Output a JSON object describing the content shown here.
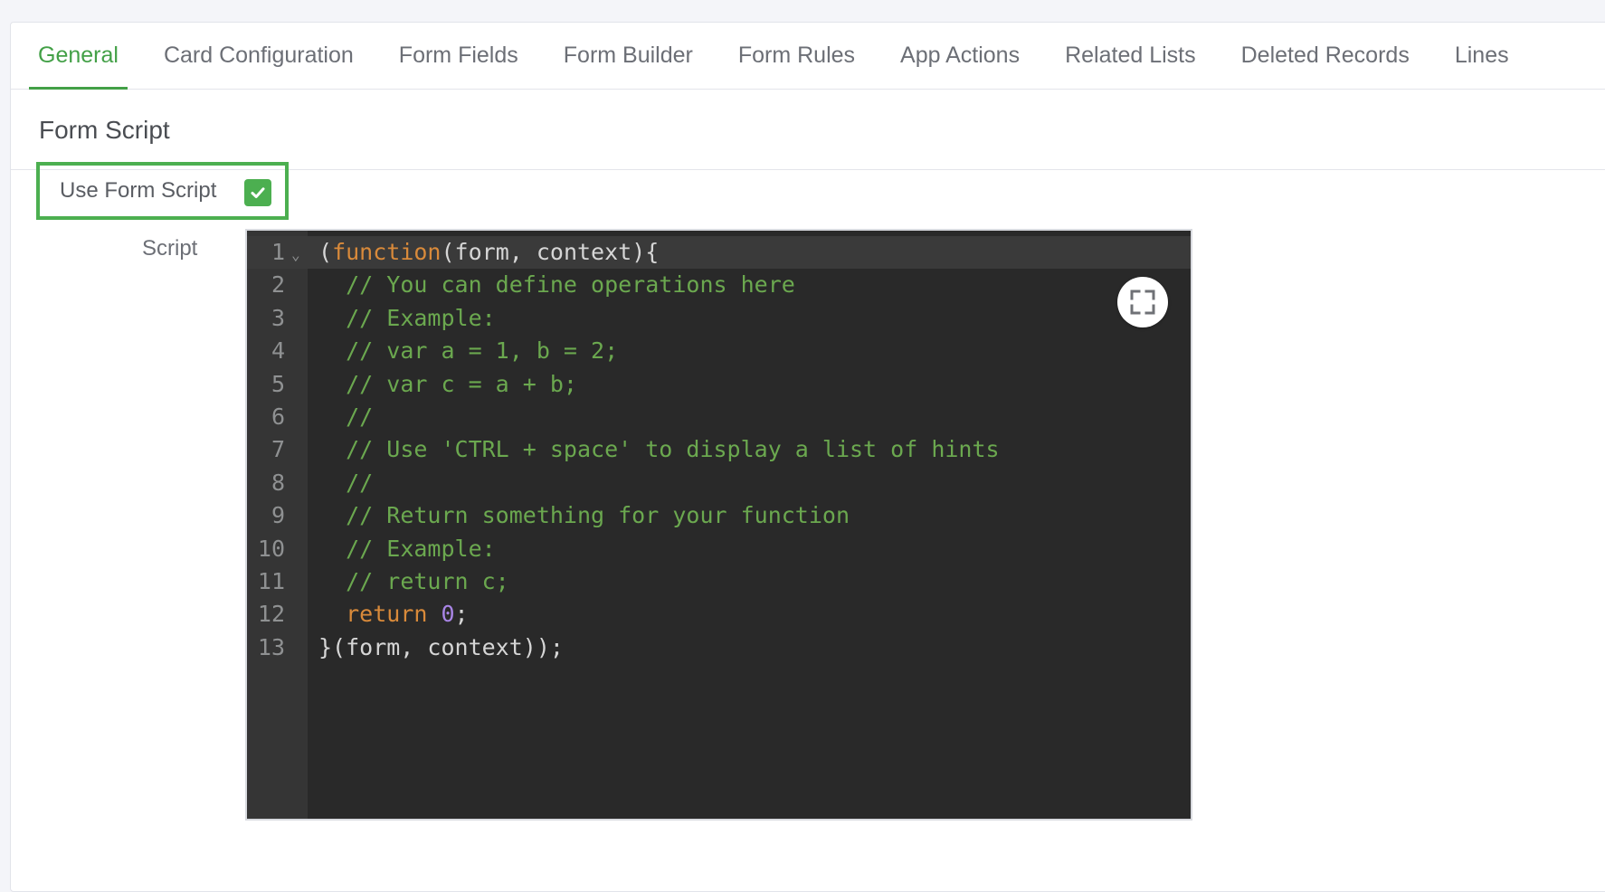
{
  "tabs": [
    {
      "label": "General",
      "active": true
    },
    {
      "label": "Card Configuration",
      "active": false
    },
    {
      "label": "Form Fields",
      "active": false
    },
    {
      "label": "Form Builder",
      "active": false
    },
    {
      "label": "Form Rules",
      "active": false
    },
    {
      "label": "App Actions",
      "active": false
    },
    {
      "label": "Related Lists",
      "active": false
    },
    {
      "label": "Deleted Records",
      "active": false
    },
    {
      "label": "Lines",
      "active": false
    }
  ],
  "section": {
    "title": "Form Script"
  },
  "use_form_script": {
    "label": "Use Form Script",
    "checked": true,
    "icon": "check-icon"
  },
  "script": {
    "label": "Script",
    "fullscreen_icon": "fullscreen-icon",
    "lines": [
      {
        "n": "1",
        "segments": [
          {
            "t": "("
          },
          {
            "t": "function",
            "c": "kw"
          },
          {
            "t": "(form, context){"
          }
        ]
      },
      {
        "n": "2",
        "segments": [
          {
            "t": "  "
          },
          {
            "t": "// You can define operations here",
            "c": "cm"
          }
        ]
      },
      {
        "n": "3",
        "segments": [
          {
            "t": "  "
          },
          {
            "t": "// Example:",
            "c": "cm"
          }
        ]
      },
      {
        "n": "4",
        "segments": [
          {
            "t": "  "
          },
          {
            "t": "// var a = 1, b = 2;",
            "c": "cm"
          }
        ]
      },
      {
        "n": "5",
        "segments": [
          {
            "t": "  "
          },
          {
            "t": "// var c = a + b;",
            "c": "cm"
          }
        ]
      },
      {
        "n": "6",
        "segments": [
          {
            "t": "  "
          },
          {
            "t": "//",
            "c": "cm"
          }
        ]
      },
      {
        "n": "7",
        "segments": [
          {
            "t": "  "
          },
          {
            "t": "// Use 'CTRL + space' to display a list of hints",
            "c": "cm"
          }
        ]
      },
      {
        "n": "8",
        "segments": [
          {
            "t": "  "
          },
          {
            "t": "//",
            "c": "cm"
          }
        ]
      },
      {
        "n": "9",
        "segments": [
          {
            "t": "  "
          },
          {
            "t": "// Return something for your function",
            "c": "cm"
          }
        ]
      },
      {
        "n": "10",
        "segments": [
          {
            "t": "  "
          },
          {
            "t": "// Example:",
            "c": "cm"
          }
        ]
      },
      {
        "n": "11",
        "segments": [
          {
            "t": "  "
          },
          {
            "t": "// return c;",
            "c": "cm"
          }
        ]
      },
      {
        "n": "12",
        "segments": [
          {
            "t": "  "
          },
          {
            "t": "return",
            "c": "kw"
          },
          {
            "t": " "
          },
          {
            "t": "0",
            "c": "num"
          },
          {
            "t": ";"
          }
        ]
      },
      {
        "n": "13",
        "segments": [
          {
            "t": "}(form, context));"
          }
        ]
      }
    ]
  },
  "colors": {
    "accent": "#43a047",
    "checkbox": "#4caf50",
    "editor_bg": "#292929",
    "keyword": "#d98a3a",
    "comment": "#6ba84f",
    "number": "#a985e6"
  }
}
